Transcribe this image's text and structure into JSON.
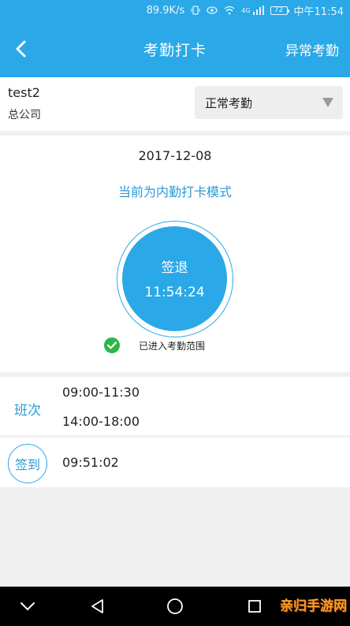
{
  "status_bar": {
    "speed": "89.9K/s",
    "network": "4G",
    "battery": "72",
    "time_label": "中午11:54"
  },
  "header": {
    "title": "考勤打卡",
    "right_action": "异常考勤"
  },
  "user": {
    "name": "test2",
    "company": "总公司"
  },
  "attendance_type": {
    "selected": "正常考勤"
  },
  "clock": {
    "date": "2017-12-08",
    "mode": "当前为内勤打卡模式",
    "button_label": "签退",
    "button_time": "11:54:24",
    "range_status": "已进入考勤范围"
  },
  "shift": {
    "label": "班次",
    "times": [
      "09:00-11:30",
      "14:00-18:00"
    ]
  },
  "signin": {
    "label": "签到",
    "time": "09:51:02"
  },
  "watermark": "亲归手游网",
  "colors": {
    "brand_blue": "#2aa8e8",
    "success_green": "#2db54a",
    "watermark_orange": "#ff9a2a"
  },
  "icons": {
    "back": "chevron-left-icon",
    "dropdown": "triangle-down-icon",
    "check": "check-circle-icon",
    "nav_down": "chevron-down-icon",
    "nav_back": "triangle-back-icon",
    "nav_home": "circle-home-icon",
    "nav_recent": "square-recent-icon"
  }
}
